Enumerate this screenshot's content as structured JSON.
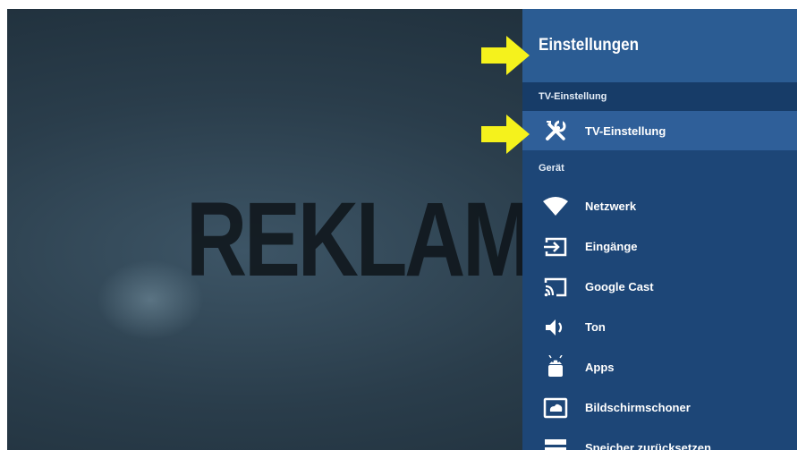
{
  "screen": {
    "background_text": "REKLAM"
  },
  "settings": {
    "title": "Einstellungen",
    "sections": [
      {
        "label": "TV-Einstellung",
        "items": [
          {
            "label": "TV-Einstellung",
            "icon": "tools-icon",
            "selected": true
          }
        ]
      },
      {
        "label": "Gerät",
        "items": [
          {
            "label": "Netzwerk",
            "icon": "wifi-icon"
          },
          {
            "label": "Eingänge",
            "icon": "input-icon"
          },
          {
            "label": "Google Cast",
            "icon": "cast-icon"
          },
          {
            "label": "Ton",
            "icon": "speaker-icon"
          },
          {
            "label": "Apps",
            "icon": "android-icon"
          },
          {
            "label": "Bildschirmschoner",
            "icon": "screensaver-icon"
          },
          {
            "label": "Speicher zurücksetzen",
            "icon": "storage-icon"
          }
        ]
      }
    ]
  },
  "colors": {
    "panel": "#1d4677",
    "header": "#2b5c93",
    "selected": "#2f5f99",
    "arrow": "#f5f21c"
  }
}
